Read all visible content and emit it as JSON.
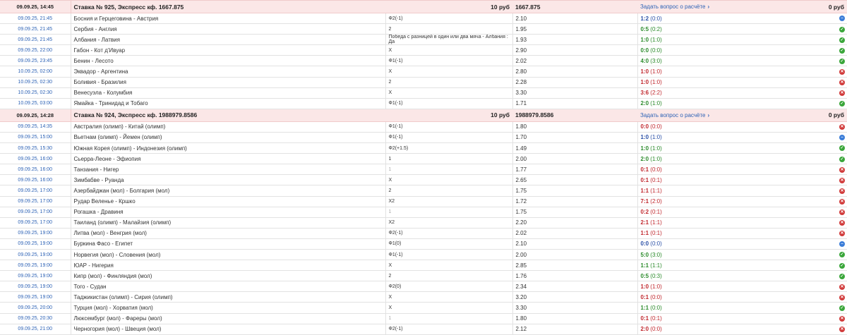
{
  "colors": {
    "header_bg": "#fbe7e7",
    "date": "#2e63b6",
    "won": "#2a8a2a",
    "lost": "#c0272d",
    "returned": "#2a4fa6",
    "link": "#2e63b6"
  },
  "icons": {
    "won": "check-circle-icon",
    "lost": "cross-circle-icon",
    "returned": "minus-circle-icon"
  },
  "bets": [
    {
      "date": "09.09.25, 14:45",
      "title": "Ставка № 925, Экспресс кф. 1667.875",
      "stake": "10 руб",
      "coef": "1667.875",
      "question": "Задать вопрос о расчёте",
      "chevron": "›",
      "winnings": "0 руб",
      "events": [
        {
          "date": "09.09.25, 21:45",
          "match": "Босния и Герцеговина - Австрия",
          "outcome": "Ф2(-1)",
          "coef": "2.10",
          "score": "1:2",
          "half": "(0:0)",
          "status": "returned"
        },
        {
          "date": "09.09.25, 21:45",
          "match": "Сербия - Англия",
          "outcome": "2",
          "coef": "1.95",
          "score": "0:5",
          "half": "(0:2)",
          "status": "won"
        },
        {
          "date": "09.09.25, 21:45",
          "match": "Албания - Латвия",
          "outcome": "Победа с разницей в один или два мяча - Албания : Да",
          "coef": "1.93",
          "score": "1:0",
          "half": "(1:0)",
          "status": "won"
        },
        {
          "date": "09.09.25, 22:00",
          "match": "Габон - Кот д'Ивуар",
          "outcome": "X",
          "coef": "2.90",
          "score": "0:0",
          "half": "(0:0)",
          "status": "won"
        },
        {
          "date": "09.09.25, 23:45",
          "match": "Бенин - Лесото",
          "outcome": "Ф1(-1)",
          "coef": "2.02",
          "score": "4:0",
          "half": "(3:0)",
          "status": "won"
        },
        {
          "date": "10.09.25, 02:00",
          "match": "Эквадор - Аргентина",
          "outcome": "X",
          "coef": "2.80",
          "score": "1:0",
          "half": "(1:0)",
          "status": "lost"
        },
        {
          "date": "10.09.25, 02:30",
          "match": "Боливия - Бразилия",
          "outcome": "2",
          "coef": "2.28",
          "score": "1:0",
          "half": "(1:0)",
          "status": "lost"
        },
        {
          "date": "10.09.25, 02:30",
          "match": "Венесуэла - Колумбия",
          "outcome": "X",
          "coef": "3.30",
          "score": "3:6",
          "half": "(2:2)",
          "status": "lost"
        },
        {
          "date": "10.09.25, 03:00",
          "match": "Ямайка - Тринидад и Тобаго",
          "outcome": "Ф1(-1)",
          "coef": "1.71",
          "score": "2:0",
          "half": "(1:0)",
          "status": "won"
        }
      ]
    },
    {
      "date": "09.09.25, 14:28",
      "title": "Ставка № 924, Экспресс кф. 1988979.8586",
      "stake": "10 руб",
      "coef": "1988979.8586",
      "question": "Задать вопрос о расчёте",
      "chevron": "›",
      "winnings": "0 руб",
      "events": [
        {
          "date": "09.09.25, 14:35",
          "match": "Австралия (олимп) - Китай (олимп)",
          "outcome": "Ф1(-1)",
          "coef": "1.80",
          "score": "0:0",
          "half": "(0:0)",
          "status": "lost"
        },
        {
          "date": "09.09.25, 15:00",
          "match": "Вьетнам (олимп) - Йемен (олимп)",
          "outcome": "Ф1(-1)",
          "coef": "1.70",
          "score": "1:0",
          "half": "(1:0)",
          "status": "returned"
        },
        {
          "date": "09.09.25, 15:30",
          "match": "Южная Корея (олимп) - Индонезия (олимп)",
          "outcome": "Ф2(+1.5)",
          "coef": "1.49",
          "score": "1:0",
          "half": "(1:0)",
          "status": "won"
        },
        {
          "date": "09.09.25, 16:00",
          "match": "Сьерра-Леоне - Эфиопия",
          "outcome": "1",
          "coef": "2.00",
          "score": "2:0",
          "half": "(1:0)",
          "status": "won"
        },
        {
          "date": "09.09.25, 16:00",
          "match": "Танзания - Нигер",
          "outcome": "1",
          "coef": "1.77",
          "score": "0:1",
          "half": "(0:0)",
          "status": "lost",
          "dim": true
        },
        {
          "date": "09.09.25, 16:00",
          "match": "Зимбабве - Руанда",
          "outcome": "X",
          "coef": "2.65",
          "score": "0:1",
          "half": "(0:1)",
          "status": "lost"
        },
        {
          "date": "09.09.25, 17:00",
          "match": "Азербайджан (мол) - Болгария (мол)",
          "outcome": "2",
          "coef": "1.75",
          "score": "1:1",
          "half": "(1:1)",
          "status": "lost"
        },
        {
          "date": "09.09.25, 17:00",
          "match": "Рудар Веленье - Кршко",
          "outcome": "X2",
          "coef": "1.72",
          "score": "7:1",
          "half": "(2:0)",
          "status": "lost"
        },
        {
          "date": "09.09.25, 17:00",
          "match": "Рогашка - Дравиня",
          "outcome": "1",
          "coef": "1.75",
          "score": "0:2",
          "half": "(0:1)",
          "status": "lost",
          "dim": true
        },
        {
          "date": "09.09.25, 17:00",
          "match": "Таиланд (олимп) - Малайзия (олимп)",
          "outcome": "X2",
          "coef": "2.20",
          "score": "2:1",
          "half": "(1:1)",
          "status": "lost"
        },
        {
          "date": "09.09.25, 19:00",
          "match": "Литва (мол) - Венгрия (мол)",
          "outcome": "Ф2(-1)",
          "coef": "2.02",
          "score": "1:1",
          "half": "(0:1)",
          "status": "lost"
        },
        {
          "date": "09.09.25, 19:00",
          "match": "Буркина Фасо - Египет",
          "outcome": "Ф1(0)",
          "coef": "2.10",
          "score": "0:0",
          "half": "(0:0)",
          "status": "returned"
        },
        {
          "date": "09.09.25, 19:00",
          "match": "Норвегия (мол) - Словения (мол)",
          "outcome": "Ф1(-1)",
          "coef": "2.00",
          "score": "5:0",
          "half": "(3:0)",
          "status": "won"
        },
        {
          "date": "09.09.25, 19:00",
          "match": "ЮАР - Нигерия",
          "outcome": "X",
          "coef": "2.85",
          "score": "1:1",
          "half": "(1:1)",
          "status": "won"
        },
        {
          "date": "09.09.25, 19:00",
          "match": "Кипр (мол) - Финляндия (мол)",
          "outcome": "2",
          "coef": "1.76",
          "score": "0:5",
          "half": "(0:3)",
          "status": "won"
        },
        {
          "date": "09.09.25, 19:00",
          "match": "Того - Судан",
          "outcome": "Ф2(0)",
          "coef": "2.34",
          "score": "1:0",
          "half": "(1:0)",
          "status": "lost"
        },
        {
          "date": "09.09.25, 19:00",
          "match": "Таджикистан (олимп) - Сирия (олимп)",
          "outcome": "X",
          "coef": "3.20",
          "score": "0:1",
          "half": "(0:0)",
          "status": "lost"
        },
        {
          "date": "09.09.25, 20:00",
          "match": "Турция (мол) - Хорватия (мол)",
          "outcome": "X",
          "coef": "3.30",
          "score": "1:1",
          "half": "(0:0)",
          "status": "won"
        },
        {
          "date": "09.09.25, 20:30",
          "match": "Люксембург (мол) - Фареры (мол)",
          "outcome": "1",
          "coef": "1.80",
          "score": "0:1",
          "half": "(0:1)",
          "status": "lost",
          "dim": true
        },
        {
          "date": "09.09.25, 21:00",
          "match": "Черногория (мол) - Швеция (мол)",
          "outcome": "Ф2(-1)",
          "coef": "2.12",
          "score": "2:0",
          "half": "(0:0)",
          "status": "lost"
        }
      ]
    }
  ]
}
